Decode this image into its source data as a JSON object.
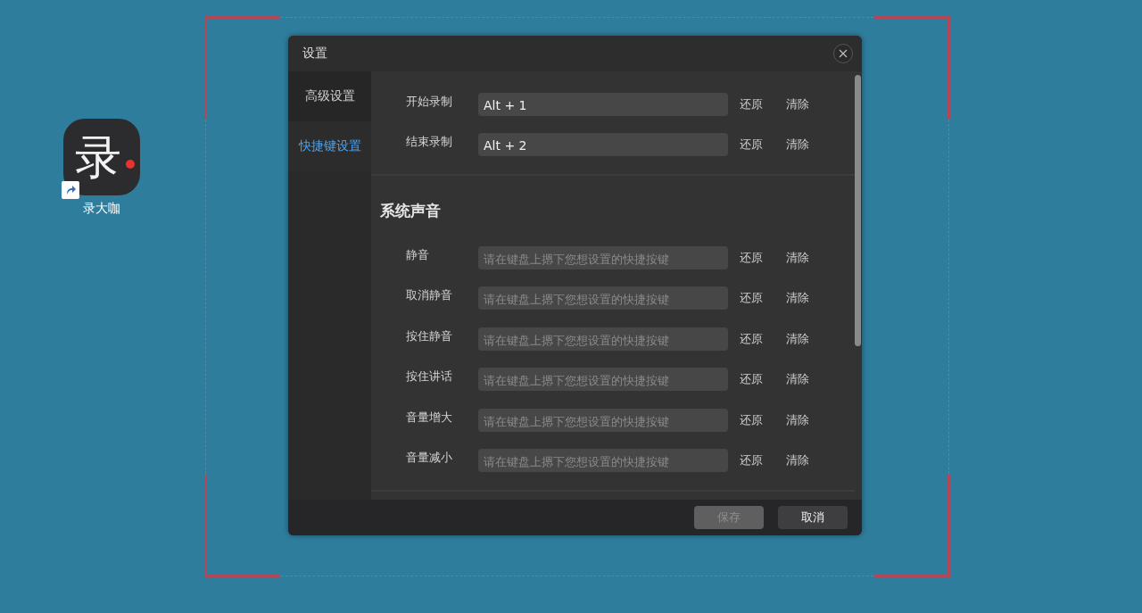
{
  "desktop_icon": {
    "glyph": "录",
    "label": "录大咖"
  },
  "window": {
    "title": "设置"
  },
  "sidebar": {
    "items": [
      {
        "label": "高级设置",
        "selected": false
      },
      {
        "label": "快捷键设置",
        "selected": true
      }
    ]
  },
  "sections": [
    {
      "rows": [
        {
          "label": "开始录制",
          "value": "Alt + 1",
          "reset": "还原",
          "clear": "清除"
        },
        {
          "label": "结束录制",
          "value": "Alt + 2",
          "reset": "还原",
          "clear": "清除"
        }
      ]
    },
    {
      "heading": "系统声音",
      "rows": [
        {
          "label": "静音",
          "placeholder": "请在键盘上摁下您想设置的快捷按键",
          "reset": "还原",
          "clear": "清除"
        },
        {
          "label": "取消静音",
          "placeholder": "请在键盘上摁下您想设置的快捷按键",
          "reset": "还原",
          "clear": "清除"
        },
        {
          "label": "按住静音",
          "placeholder": "请在键盘上摁下您想设置的快捷按键",
          "reset": "还原",
          "clear": "清除"
        },
        {
          "label": "按住讲话",
          "placeholder": "请在键盘上摁下您想设置的快捷按键",
          "reset": "还原",
          "clear": "清除"
        },
        {
          "label": "音量增大",
          "placeholder": "请在键盘上摁下您想设置的快捷按键",
          "reset": "还原",
          "clear": "清除"
        },
        {
          "label": "音量减小",
          "placeholder": "请在键盘上摁下您想设置的快捷按键",
          "reset": "还原",
          "clear": "清除"
        }
      ]
    }
  ],
  "footer": {
    "buttons": [
      {
        "label": "保存",
        "disabled": true
      },
      {
        "label": "取消",
        "disabled": false
      }
    ]
  }
}
